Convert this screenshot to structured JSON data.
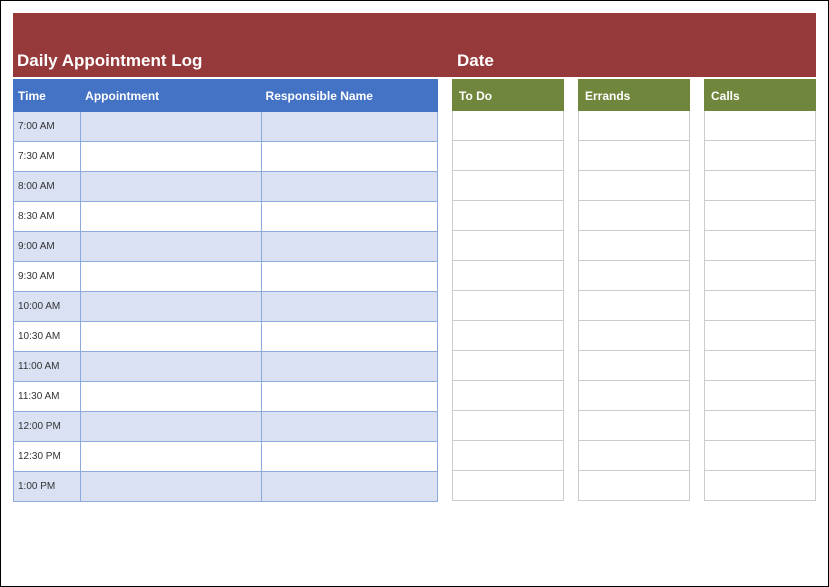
{
  "banner": {
    "title": "Daily Appointment Log",
    "date_label": "Date"
  },
  "appointments": {
    "headers": {
      "time": "Time",
      "appointment": "Appointment",
      "responsible": "Responsible Name"
    },
    "rows": [
      {
        "time": "7:00 AM",
        "appointment": "",
        "responsible": ""
      },
      {
        "time": "7:30 AM",
        "appointment": "",
        "responsible": ""
      },
      {
        "time": "8:00 AM",
        "appointment": "",
        "responsible": ""
      },
      {
        "time": "8:30 AM",
        "appointment": "",
        "responsible": ""
      },
      {
        "time": "9:00 AM",
        "appointment": "",
        "responsible": ""
      },
      {
        "time": "9:30 AM",
        "appointment": "",
        "responsible": ""
      },
      {
        "time": "10:00 AM",
        "appointment": "",
        "responsible": ""
      },
      {
        "time": "10:30 AM",
        "appointment": "",
        "responsible": ""
      },
      {
        "time": "11:00 AM",
        "appointment": "",
        "responsible": ""
      },
      {
        "time": "11:30 AM",
        "appointment": "",
        "responsible": ""
      },
      {
        "time": "12:00 PM",
        "appointment": "",
        "responsible": ""
      },
      {
        "time": "12:30 PM",
        "appointment": "",
        "responsible": ""
      },
      {
        "time": "1:00 PM",
        "appointment": "",
        "responsible": ""
      }
    ]
  },
  "side_columns": [
    {
      "header": "To Do",
      "rows": 13
    },
    {
      "header": "Errands",
      "rows": 13
    },
    {
      "header": "Calls",
      "rows": 13
    }
  ]
}
